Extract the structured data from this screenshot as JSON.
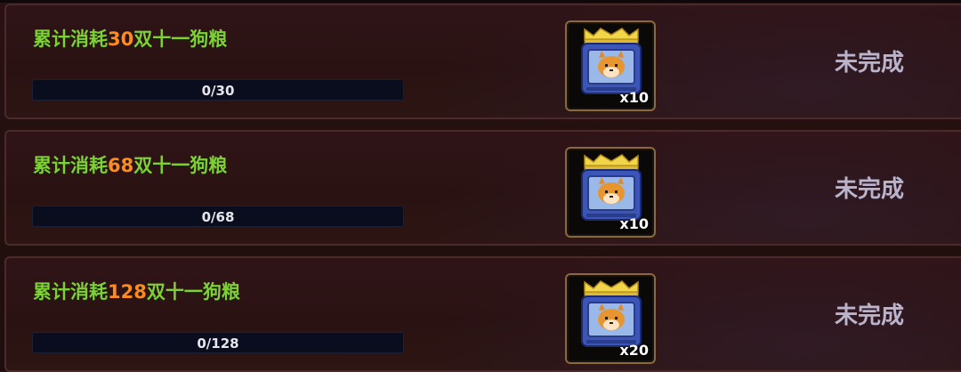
{
  "tasks": [
    {
      "title_prefix": "累计消耗",
      "amount": "30",
      "title_suffix": "双十一狗粮",
      "progress_text": "0/30",
      "progress": 0,
      "reward_qty": "x10",
      "status": "未完成"
    },
    {
      "title_prefix": "累计消耗",
      "amount": "68",
      "title_suffix": "双十一狗粮",
      "progress_text": "0/68",
      "progress": 0,
      "reward_qty": "x10",
      "status": "未完成"
    },
    {
      "title_prefix": "累计消耗",
      "amount": "128",
      "title_suffix": "双十一狗粮",
      "progress_text": "0/128",
      "progress": 0,
      "reward_qty": "x20",
      "status": "未完成"
    }
  ],
  "reward_icon": "dog-food-can-icon",
  "colors": {
    "title_green": "#7fd037",
    "amount_orange": "#ff8a1f",
    "status_grey": "#b9b3cc"
  }
}
